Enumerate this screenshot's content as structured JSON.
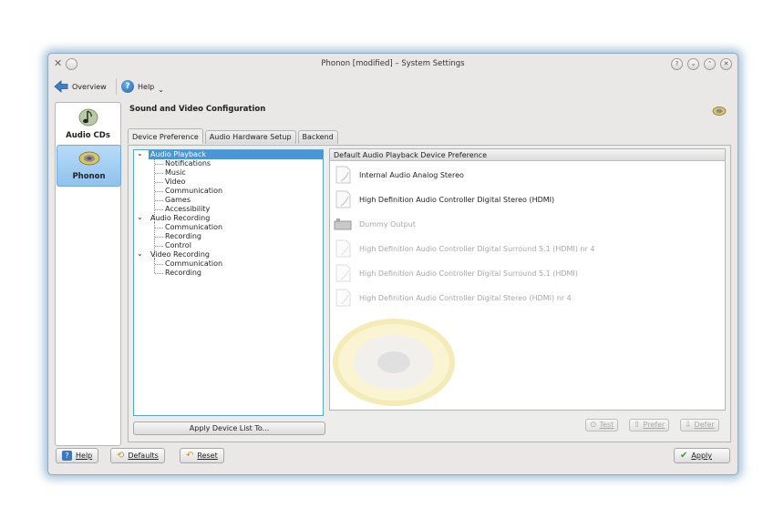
{
  "window": {
    "title": "Phonon [modified] – System Settings",
    "controls": [
      "?",
      "⌄",
      "⌃",
      "✕"
    ]
  },
  "toolbar": {
    "overview": "Overview",
    "help": "Help"
  },
  "sidebar": {
    "items": [
      {
        "label": "Audio CDs"
      },
      {
        "label": "Phonon"
      }
    ]
  },
  "module": {
    "title": "Sound and Video Configuration"
  },
  "tabs": [
    {
      "label": "Device Preference"
    },
    {
      "label": "Audio Hardware Setup"
    },
    {
      "label": "Backend"
    }
  ],
  "tree": {
    "groups": [
      {
        "label": "Audio Playback",
        "children": [
          "Notifications",
          "Music",
          "Video",
          "Communication",
          "Games",
          "Accessibility"
        ]
      },
      {
        "label": "Audio Recording",
        "children": [
          "Communication",
          "Recording",
          "Control"
        ]
      },
      {
        "label": "Video Recording",
        "children": [
          "Communication",
          "Recording"
        ]
      }
    ]
  },
  "apply_list_button": "Apply Device List To...",
  "device_list": {
    "header": "Default Audio Playback Device Preference",
    "devices": [
      {
        "name": "Internal Audio Analog Stereo"
      },
      {
        "name": "High Definition Audio Controller Digital Stereo (HDMI)"
      },
      {
        "name": "Dummy Output"
      },
      {
        "name": "High Definition Audio Controller Digital Surround 5.1 (HDMI) nr 4"
      },
      {
        "name": "High Definition Audio Controller Digital Surround 5.1 (HDMI)"
      },
      {
        "name": "High Definition Audio Controller Digital Stereo (HDMI) nr 4"
      }
    ]
  },
  "device_actions": {
    "test": "Test",
    "prefer": "Prefer",
    "defer": "Defer"
  },
  "bottom": {
    "help": "Help",
    "defaults": "Defaults",
    "reset": "Reset",
    "apply": "Apply"
  },
  "colors": {
    "selection": "#4a95d7",
    "window_border": "#8fa9bf",
    "sidebar_selected": "#9fcdf3"
  }
}
